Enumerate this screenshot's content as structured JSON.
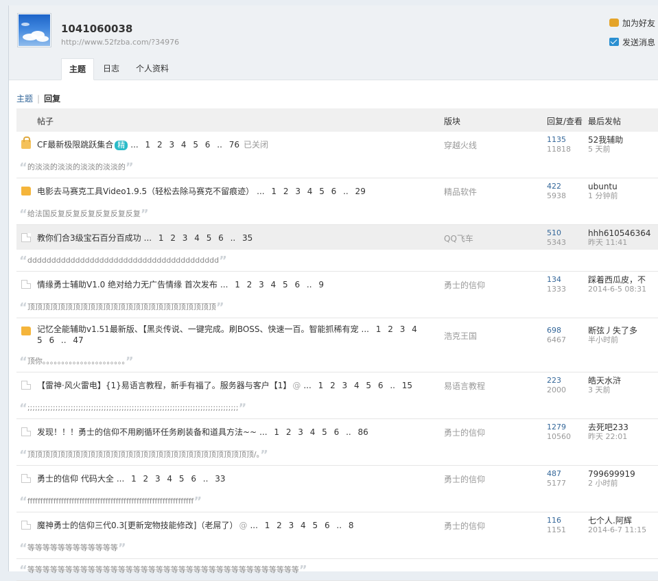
{
  "profile": {
    "username": "1041060038",
    "url": "http://www.52fzba.com/?34976",
    "add_friend": "加为好友",
    "send_message": "发送消息",
    "avatar_icon": "sky-avatar"
  },
  "tabs": [
    "主题",
    "日志",
    "个人资料"
  ],
  "subtabs": {
    "topics": "主题",
    "replies": "回复"
  },
  "columns": {
    "post": "帖子",
    "forum": "版块",
    "stats": "回复/查看",
    "last": "最后发帖"
  },
  "threads": [
    {
      "icon": "lock",
      "title": "CF最新极限跳跃集合",
      "badge": "精",
      "pager": "... 1 2 3 4 5 6 .. 76",
      "extra": "已关闭",
      "forum": "穿越火线",
      "replies": "1135",
      "views": "11818",
      "last_user": "52我辅助",
      "last_time": "5 天前",
      "quote": "的淡淡的淡淡的淡淡的淡淡的"
    },
    {
      "icon": "folder",
      "title": "电影去马赛克工具Video1.9.5（轻松去除马赛克不留痕迹）",
      "pager": "... 1 2 3 4 5 6 .. 29",
      "forum": "精品软件",
      "replies": "422",
      "views": "5938",
      "last_user": "ubuntu",
      "last_time": "1 分钟前",
      "quote": "给法国反复反复反复反复反复反复"
    },
    {
      "icon": "doc",
      "title": "教你们合3级宝石百分百成功",
      "pager": "... 1 2 3 4 5 6 .. 35",
      "forum": "QQ飞车",
      "replies": "510",
      "views": "5343",
      "last_user": "hhh610546364",
      "last_time": "昨天 11:41",
      "quote": "dddddddddddddddddddddddddddddddddddddddd",
      "highlight": true
    },
    {
      "icon": "doc",
      "title": "情缘勇士辅助V1.0 绝对给力无广告情缘 首次发布",
      "pager": "... 1 2 3 4 5 6 .. 9",
      "forum": "勇士的信仰",
      "replies": "134",
      "views": "1333",
      "last_user": "踩着西瓜皮，不",
      "last_time": "2014-6-5 08:31",
      "quote": "顶顶顶顶顶顶顶顶顶顶顶顶顶顶顶顶顶顶顶顶顶顶顶顶顶"
    },
    {
      "icon": "folder",
      "title": "记忆全能辅助v1.51最新版、【黑炎传说、一键完成。刷BOSS、快速一百。智能抓稀有宠",
      "pager": "... 1 2 3 4 5 6 .. 47",
      "forum": "浩克王国",
      "replies": "698",
      "views": "6467",
      "last_user": "断弦丿失了多",
      "last_time": "半小时前",
      "quote": "顶你。。。。。。。。。。。。。。。。。。。。。。",
      "tall": true
    },
    {
      "icon": "doc",
      "title": "【雷神·风火雷电】{1}易语言教程，新手有福了。服务器与客户【1】",
      "attach": "@",
      "pager": "... 1 2 3 4 5 6 .. 15",
      "forum": "易语言教程",
      "replies": "223",
      "views": "2000",
      "last_user": "皓天水浒",
      "last_time": "3 天前",
      "quote": ";;;;;;;;;;;;;;;;;;;;;;;;;;;;;;;;;;;;;;;;;;;;;;;;;;;;;;;;;;;;;;;;;;;;;;;;;;;;;;;;;;;"
    },
    {
      "icon": "doc",
      "title": "发现！！！勇士的信仰不用刷循环任务刷装备和道具方法~~",
      "pager": "... 1 2 3 4 5 6 .. 86",
      "forum": "勇士的信仰",
      "replies": "1279",
      "views": "10560",
      "last_user": "去死吧233",
      "last_time": "昨天 22:01",
      "quote": "顶顶顶顶顶顶顶顶顶顶顶顶顶顶顶顶顶顶顶顶顶顶顶顶顶顶顶顶顶顶/。"
    },
    {
      "icon": "doc",
      "title": "勇士的信仰 代码大全",
      "pager": "... 1 2 3 4 5 6 .. 33",
      "forum": "勇士的信仰",
      "replies": "487",
      "views": "5177",
      "last_user": "799699919",
      "last_time": "2 小时前",
      "quote": "ffffffffffffffffffffffffffffffffffffffffffffffffffffffffffffffff"
    },
    {
      "icon": "doc",
      "title": "魔神勇士的信仰三代0.3[更新宠物技能修改]（老屌了）",
      "attach": "@",
      "pager": "... 1 2 3 4 5 6 .. 8",
      "forum": "勇士的信仰",
      "replies": "116",
      "views": "1151",
      "last_user": "七个人.阿辉",
      "last_time": "2014-6-7 11:15",
      "quote": "等等等等等等等等等等等等"
    }
  ],
  "trailing_quote": "等等等等等等等等等等等等等等等等等等等等等等等等等等等等等等等等等等等等"
}
